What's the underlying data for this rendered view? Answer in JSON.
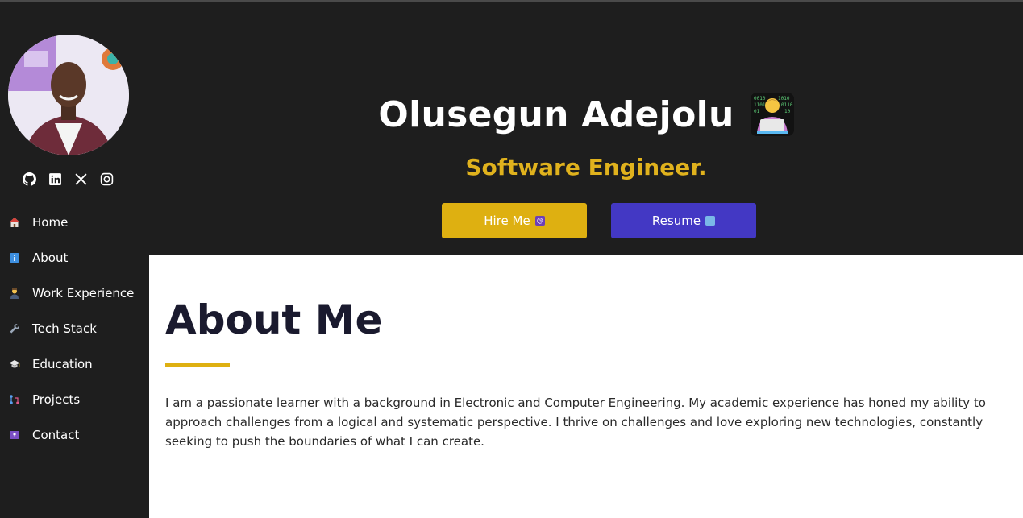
{
  "profile": {
    "name": "Olusegun Adejolu",
    "title": "Software Engineer."
  },
  "socials": [
    "github-icon",
    "linkedin-icon",
    "x-icon",
    "instagram-icon"
  ],
  "nav": {
    "items": [
      {
        "label": "Home",
        "icon": "home-icon"
      },
      {
        "label": "About",
        "icon": "info-icon"
      },
      {
        "label": "Work Experience",
        "icon": "worker-icon"
      },
      {
        "label": "Tech Stack",
        "icon": "wrench-icon"
      },
      {
        "label": "Education",
        "icon": "graduation-cap-icon"
      },
      {
        "label": "Projects",
        "icon": "projects-icon"
      },
      {
        "label": "Contact",
        "icon": "contact-card-icon"
      }
    ]
  },
  "hero": {
    "hire_label": "Hire Me",
    "resume_label": "Resume"
  },
  "about": {
    "title": "About Me",
    "text": "I am a passionate learner with a background in Electronic and Computer Engineering. My academic experience has honed my ability to approach challenges from a logical and systematic perspective. I thrive on challenges and love exploring new technologies, constantly seeking to push the boundaries of what I can create."
  },
  "colors": {
    "background": "#1e1e1e",
    "accent": "#deb011",
    "resume_button": "#4338c4",
    "about_bg": "#ffffff"
  }
}
